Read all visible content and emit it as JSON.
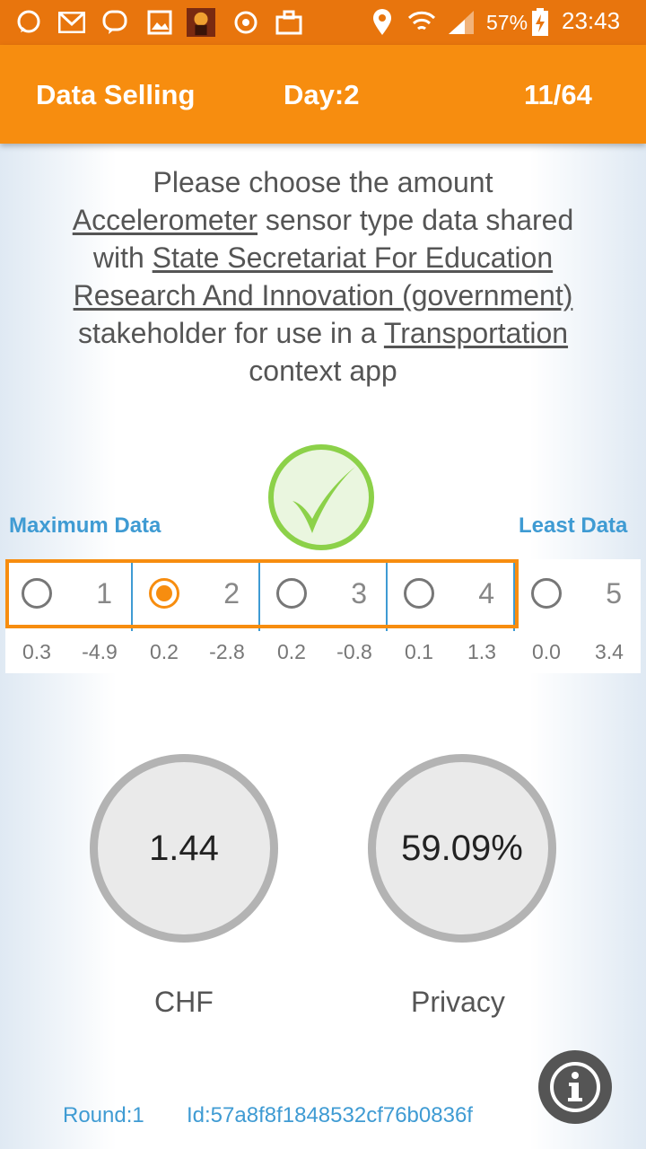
{
  "status_bar": {
    "icons": [
      "whatsapp-icon",
      "gmail-icon",
      "viber-icon",
      "gallery-icon",
      "game-icon",
      "sync-icon",
      "briefcase-icon"
    ],
    "right_icons": [
      "location-icon",
      "wifi-icon",
      "signal-icon",
      "battery-charging-icon"
    ],
    "battery": "57%",
    "time": "23:43"
  },
  "app_bar": {
    "title": "Data Selling",
    "day": "Day:2",
    "progress": "11/64"
  },
  "question": {
    "part1": "Please choose the amount",
    "sensor": "Accelerometer",
    "part2": " sensor type data shared with",
    "stakeholder": "State Secretariat For Education Research And Innovation (government)",
    "part3": " stakeholder for use in a",
    "context": "Transportation",
    "part4": " context app"
  },
  "labels": {
    "max": "Maximum Data",
    "least": "Least Data"
  },
  "options": [
    {
      "label": "1",
      "selected": false
    },
    {
      "label": "2",
      "selected": true
    },
    {
      "label": "3",
      "selected": false
    },
    {
      "label": "4",
      "selected": false
    },
    {
      "label": "5",
      "selected": false
    }
  ],
  "values": [
    "0.3",
    "-4.9",
    "0.2",
    "-2.8",
    "0.2",
    "-0.8",
    "0.1",
    "1.3",
    "0.0",
    "3.4"
  ],
  "gauges": {
    "chf_value": "1.44",
    "chf_label": "CHF",
    "privacy_value": "59.09%",
    "privacy_label": "Privacy"
  },
  "footer": {
    "round": "Round:1",
    "id": "Id:57a8f8f1848532cf76b0836f"
  },
  "colors": {
    "accent": "#f78d0f",
    "status_bar": "#e8750d",
    "blue": "#3f9bd3",
    "check_green": "#8cd149"
  }
}
